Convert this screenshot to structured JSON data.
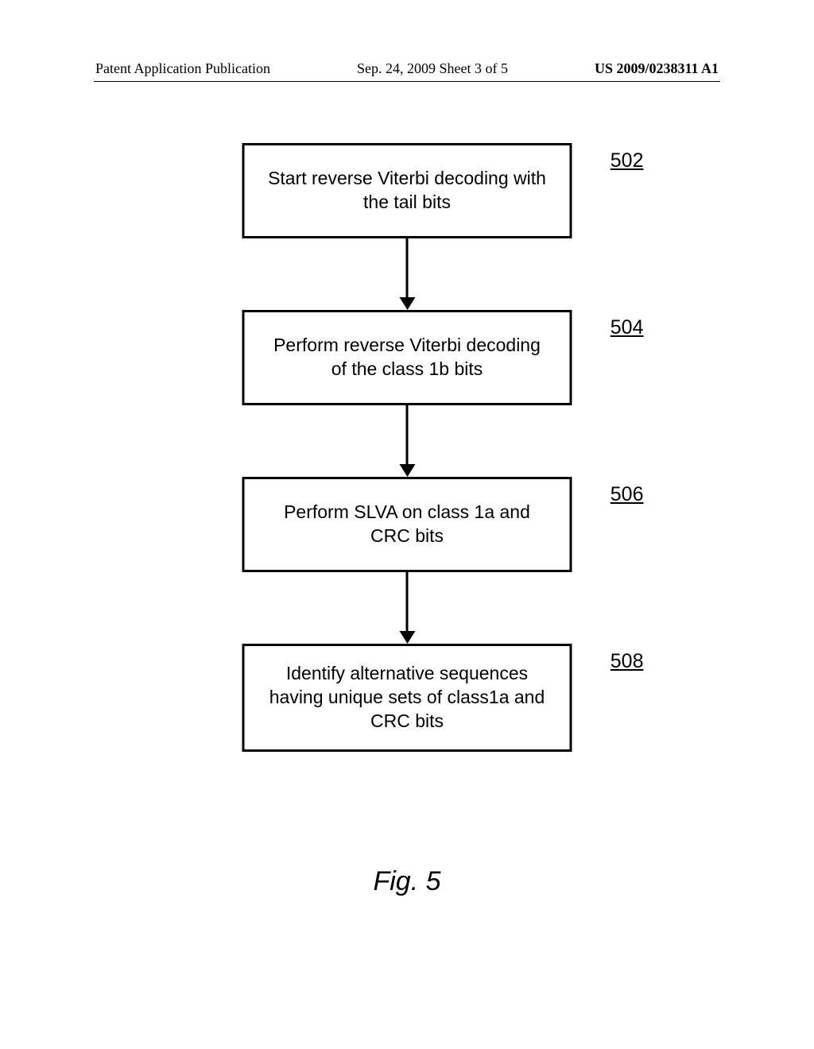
{
  "header": {
    "left": "Patent Application Publication",
    "center": "Sep. 24, 2009  Sheet 3 of 5",
    "right": "US 2009/0238311 A1"
  },
  "flowchart": {
    "steps": [
      {
        "ref": "502",
        "text": "Start reverse Viterbi decoding with the tail bits"
      },
      {
        "ref": "504",
        "text": "Perform reverse Viterbi decoding of the class 1b bits"
      },
      {
        "ref": "506",
        "text": "Perform SLVA on class 1a and CRC bits"
      },
      {
        "ref": "508",
        "text": "Identify alternative sequences having unique sets of class1a and CRC bits"
      }
    ]
  },
  "caption": "Fig. 5"
}
